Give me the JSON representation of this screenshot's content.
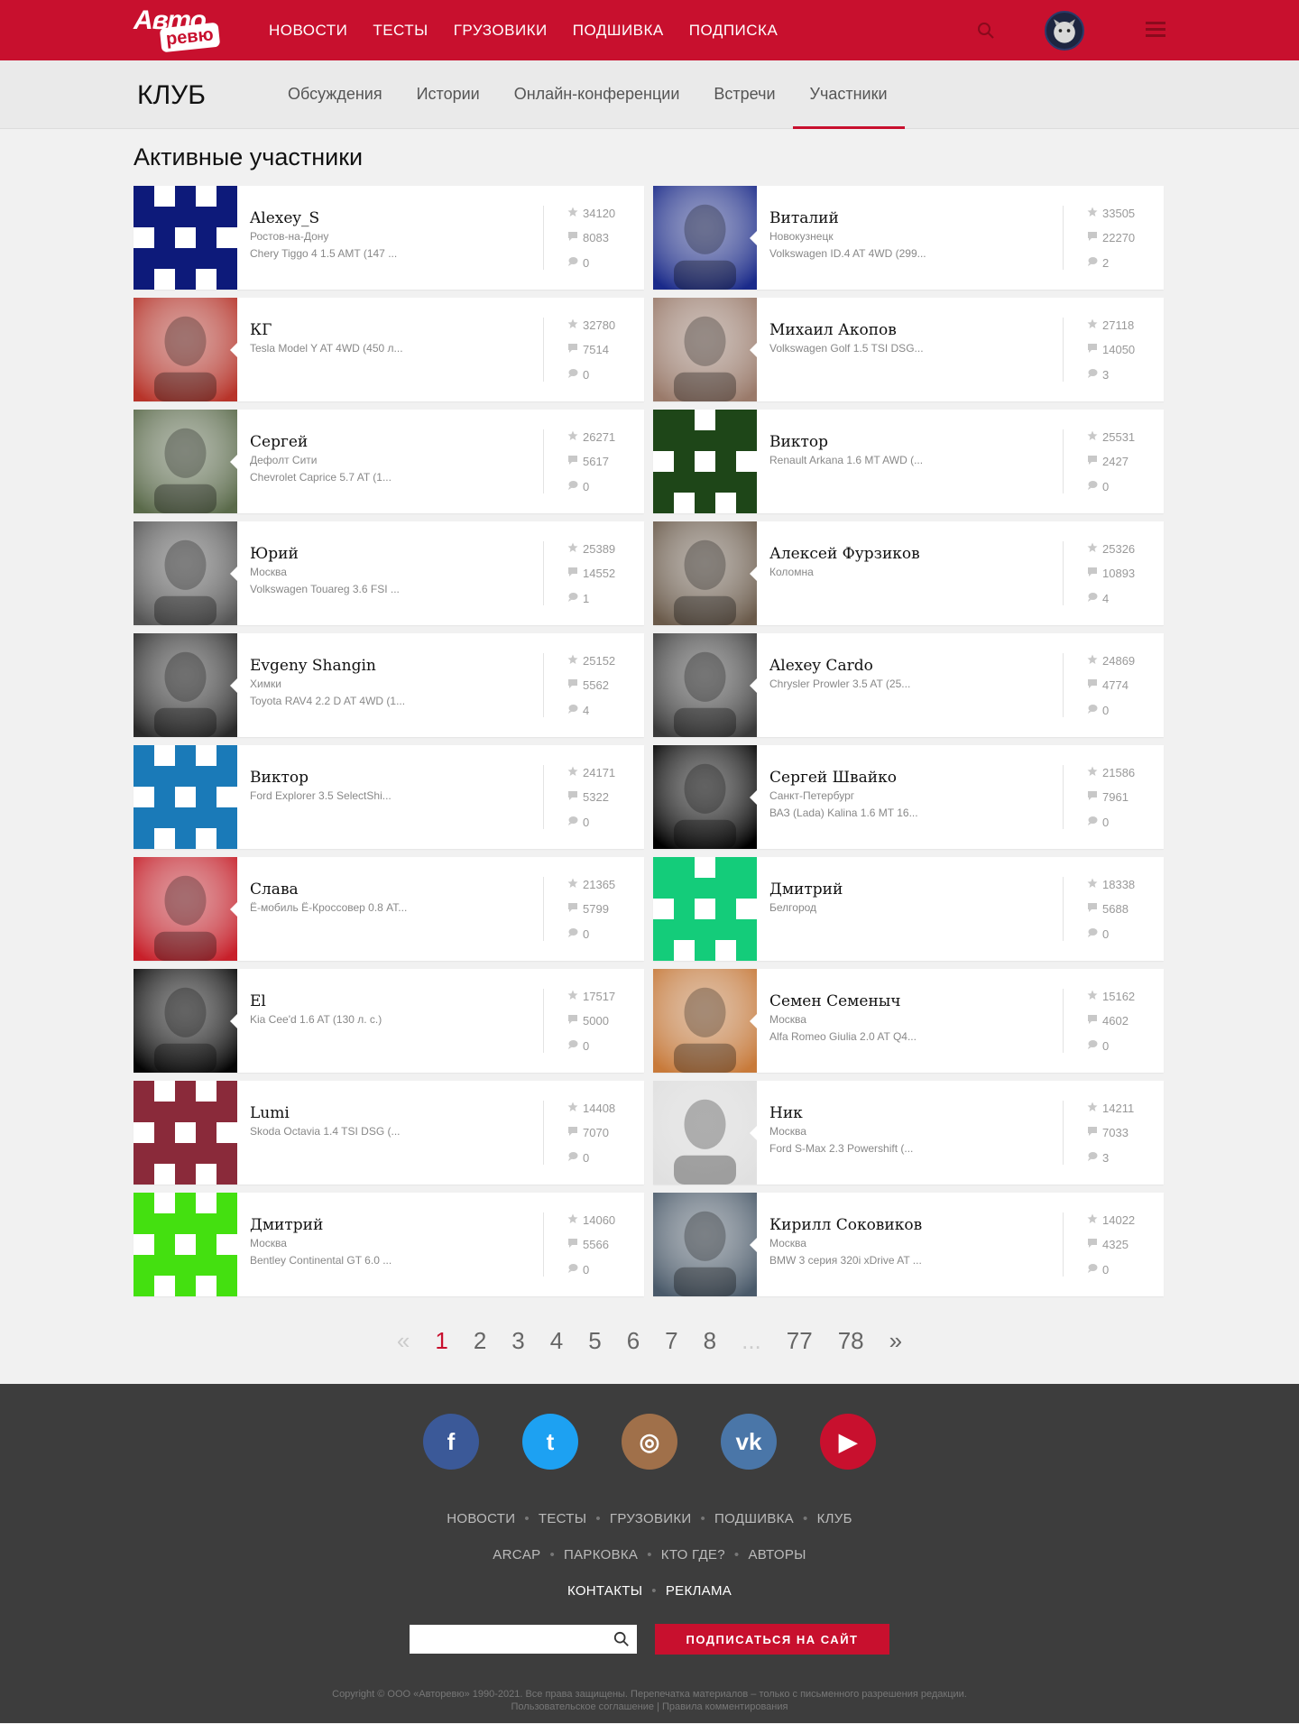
{
  "header": {
    "logo_top": "Авто",
    "logo_bottom": "ревю",
    "nav": [
      "НОВОСТИ",
      "ТЕСТЫ",
      "ГРУЗОВИКИ",
      "ПОДШИВКА",
      "ПОДПИСКА"
    ],
    "brand_color": "#c8102e"
  },
  "club": {
    "title": "КЛУБ",
    "tabs": [
      "Обсуждения",
      "Истории",
      "Онлайн-конференции",
      "Встречи",
      "Участники"
    ],
    "active_tab": "Участники"
  },
  "section_title": "Активные участники",
  "members": [
    {
      "name": "Alexey_S",
      "city": "Ростов-на-Дону",
      "car": "Chery Tiggo 4 1.5 AMT (147 ...",
      "rating": "34120",
      "comments": "8083",
      "posts": "0",
      "avatar": {
        "type": "pattern",
        "color": "#0d1a7a"
      }
    },
    {
      "name": "Виталий",
      "city": "Новокузнецк",
      "car": "Volkswagen ID.4 AT 4WD (299...",
      "rating": "33505",
      "comments": "22270",
      "posts": "2",
      "avatar": {
        "type": "photo",
        "color": "#1a2a8a"
      }
    },
    {
      "name": "КГ",
      "city": "",
      "car": "Tesla Model Y AT 4WD (450 л...",
      "rating": "32780",
      "comments": "7514",
      "posts": "0",
      "avatar": {
        "type": "photo",
        "color": "#b8342a"
      }
    },
    {
      "name": "Михаил Акопов",
      "city": "",
      "car": "Volkswagen Golf 1.5 TSI DSG...",
      "rating": "27118",
      "comments": "14050",
      "posts": "3",
      "avatar": {
        "type": "photo",
        "color": "#9a7a6a"
      }
    },
    {
      "name": "Сергей",
      "city": "Дефолт Сити",
      "car": "Chevrolet Caprice 5.7 AT (1...",
      "rating": "26271",
      "comments": "5617",
      "posts": "0",
      "avatar": {
        "type": "photo",
        "color": "#5a6a4a"
      }
    },
    {
      "name": "Виктор",
      "city": "",
      "car": "Renault Arkana 1.6 MT AWD (...",
      "rating": "25531",
      "comments": "2427",
      "posts": "0",
      "avatar": {
        "type": "pattern",
        "color": "#1e4618"
      }
    },
    {
      "name": "Юрий",
      "city": "Москва",
      "car": "Volkswagen Touareg 3.6 FSI ...",
      "rating": "25389",
      "comments": "14552",
      "posts": "1",
      "avatar": {
        "type": "photo",
        "color": "#555555"
      }
    },
    {
      "name": "Алексей Фурзиков",
      "city": "Коломна",
      "car": "",
      "rating": "25326",
      "comments": "10893",
      "posts": "4",
      "avatar": {
        "type": "photo",
        "color": "#6a5a4a"
      }
    },
    {
      "name": "Evgeny Shangin",
      "city": "Химки",
      "car": "Toyota RAV4 2.2 D AT 4WD (1...",
      "rating": "25152",
      "comments": "5562",
      "posts": "4",
      "avatar": {
        "type": "photo",
        "color": "#2a2a2a"
      }
    },
    {
      "name": "Alexey Cardo",
      "city": "",
      "car": "Chrysler Prowler 3.5 AT (25...",
      "rating": "24869",
      "comments": "4774",
      "posts": "0",
      "avatar": {
        "type": "photo",
        "color": "#3a3a3a"
      }
    },
    {
      "name": "Виктор",
      "city": "",
      "car": "Ford Explorer 3.5 SelectShi...",
      "rating": "24171",
      "comments": "5322",
      "posts": "0",
      "avatar": {
        "type": "pattern",
        "color": "#1a7ab8"
      }
    },
    {
      "name": "Сергей Швайко",
      "city": "Санкт-Петербург",
      "car": "ВАЗ (Lada) Kalina 1.6 MT 16...",
      "rating": "21586",
      "comments": "7961",
      "posts": "0",
      "avatar": {
        "type": "photo",
        "color": "#000000"
      }
    },
    {
      "name": "Слава",
      "city": "",
      "car": "Ё-мобиль Ё-Кроссовер 0.8 AT...",
      "rating": "21365",
      "comments": "5799",
      "posts": "0",
      "avatar": {
        "type": "photo",
        "color": "#c8202a"
      }
    },
    {
      "name": "Дмитрий",
      "city": "Белгород",
      "car": "",
      "rating": "18338",
      "comments": "5688",
      "posts": "0",
      "avatar": {
        "type": "pattern",
        "color": "#14cc7a"
      }
    },
    {
      "name": "El",
      "city": "",
      "car": "Kia Cee'd 1.6 AT (130 л. с.)",
      "rating": "17517",
      "comments": "5000",
      "posts": "0",
      "avatar": {
        "type": "photo",
        "color": "#050505"
      }
    },
    {
      "name": "Семен Семеныч",
      "city": "Москва",
      "car": "Alfa Romeo Giulia 2.0 AT Q4...",
      "rating": "15162",
      "comments": "4602",
      "posts": "0",
      "avatar": {
        "type": "photo",
        "color": "#c87a3a"
      }
    },
    {
      "name": "Lumi",
      "city": "",
      "car": "Skoda Octavia 1.4 TSI DSG (...",
      "rating": "14408",
      "comments": "7070",
      "posts": "0",
      "avatar": {
        "type": "pattern",
        "color": "#8a2a3a"
      }
    },
    {
      "name": "Ник",
      "city": "Москва",
      "car": "Ford S-Max 2.3 Powershift (...",
      "rating": "14211",
      "comments": "7033",
      "posts": "3",
      "avatar": {
        "type": "photo",
        "color": "#e0e0e0"
      }
    },
    {
      "name": "Дмитрий",
      "city": "Москва",
      "car": "Bentley Continental GT 6.0 ...",
      "rating": "14060",
      "comments": "5566",
      "posts": "0",
      "avatar": {
        "type": "pattern",
        "color": "#44e010"
      }
    },
    {
      "name": "Кирилл Соковиков",
      "city": "Москва",
      "car": "BMW 3 серия 320i xDrive AT ...",
      "rating": "14022",
      "comments": "4325",
      "posts": "0",
      "avatar": {
        "type": "photo",
        "color": "#4a5a6a"
      }
    }
  ],
  "pagination": {
    "prev": "«",
    "pages": [
      "1",
      "2",
      "3",
      "4",
      "5",
      "6",
      "7",
      "8"
    ],
    "ellipsis": "...",
    "last_pages": [
      "77",
      "78"
    ],
    "next": "»",
    "current": "1"
  },
  "footer": {
    "socials": [
      {
        "name": "facebook",
        "glyph": "f",
        "color": "#3b5998"
      },
      {
        "name": "twitter",
        "glyph": "t",
        "color": "#1da1f2"
      },
      {
        "name": "instagram",
        "glyph": "◎",
        "color": "#a0704a"
      },
      {
        "name": "vk",
        "glyph": "vk",
        "color": "#4a76a8"
      },
      {
        "name": "youtube",
        "glyph": "▶",
        "color": "#c8102e"
      }
    ],
    "nav_row1": [
      "НОВОСТИ",
      "ТЕСТЫ",
      "ГРУЗОВИКИ",
      "ПОДШИВКА",
      "КЛУБ"
    ],
    "nav_row2": [
      "ARCAP",
      "ПАРКОВКА",
      "КТО ГДЕ?",
      "АВТОРЫ"
    ],
    "nav_row3": [
      "КОНТАКТЫ",
      "РЕКЛАМА"
    ],
    "search_placeholder": "",
    "subscribe_label": "ПОДПИСАТЬСЯ НА САЙТ",
    "copyright": "Copyright © ООО «Авторевю» 1990-2021. Все права защищены. Перепечатка материалов – только с письменного разрешения редакции.",
    "link_agreement": "Пользовательское соглашение",
    "link_separator": "|",
    "link_rules": "Правила комментирования"
  }
}
